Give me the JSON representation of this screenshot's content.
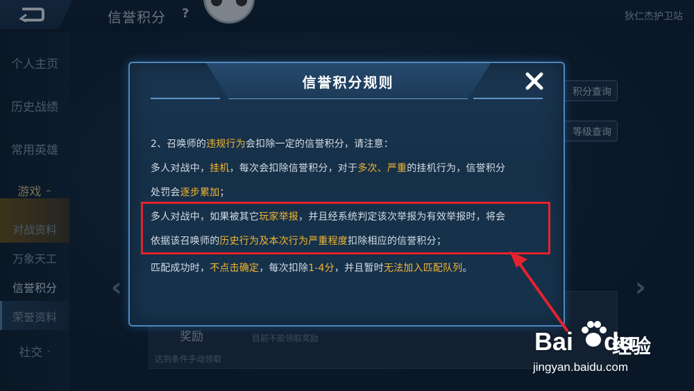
{
  "header": {
    "title": "信誉积分",
    "help_symbol": "?",
    "username": "狄仁杰护卫站"
  },
  "sidebar": {
    "items": [
      {
        "label": "个人主页"
      },
      {
        "label": "历史战绩"
      },
      {
        "label": "常用英雄"
      },
      {
        "label": "游戏"
      },
      {
        "label": "对战资料"
      },
      {
        "label": "万象天工"
      },
      {
        "label": "信誉积分"
      },
      {
        "label": "荣誉资料"
      },
      {
        "label": "社交"
      }
    ]
  },
  "main": {
    "score_query_button": "积分查询",
    "level_query_button": "等级查询",
    "reward_title": "奖励",
    "reward_subtitle": "达到条件手动领取",
    "reward_status": "目前不能领取奖励"
  },
  "modal": {
    "title": "信誉积分规则",
    "lines": [
      {
        "segments": [
          {
            "text": "2、召唤师的",
            "highlight": false
          },
          {
            "text": "违规行为",
            "highlight": true
          },
          {
            "text": "会扣除一定的信誉积分，请注意：",
            "highlight": false
          }
        ]
      },
      {
        "segments": [
          {
            "text": "多人对战中，",
            "highlight": false
          },
          {
            "text": "挂机",
            "highlight": true
          },
          {
            "text": "，每次会扣除信誉积分，对于",
            "highlight": false
          },
          {
            "text": "多次、严重",
            "highlight": true
          },
          {
            "text": "的挂机行为，信誉积分",
            "highlight": false
          }
        ]
      },
      {
        "segments": [
          {
            "text": "处罚会",
            "highlight": false
          },
          {
            "text": "逐步累加",
            "highlight": true
          },
          {
            "text": "；",
            "highlight": false
          }
        ]
      },
      {
        "segments": [
          {
            "text": "多人对战中，如果被其它",
            "highlight": false
          },
          {
            "text": "玩家举报",
            "highlight": true
          },
          {
            "text": "，并且经系统判定该次举报为有效举报时，将会",
            "highlight": false
          }
        ]
      },
      {
        "segments": [
          {
            "text": "依据该召唤师的",
            "highlight": false
          },
          {
            "text": "历史行为及本次行为严重程度",
            "highlight": true
          },
          {
            "text": "扣除相应的信誉积分；",
            "highlight": false
          }
        ]
      },
      {
        "segments": [
          {
            "text": "匹配成功时，",
            "highlight": false
          },
          {
            "text": "不点击确定",
            "highlight": true
          },
          {
            "text": "，每次扣除",
            "highlight": false
          },
          {
            "text": "1-4分",
            "highlight": true
          },
          {
            "text": "，并且暂时",
            "highlight": false
          },
          {
            "text": "无法加入匹配队列",
            "highlight": true
          },
          {
            "text": "。",
            "highlight": false
          }
        ]
      }
    ]
  },
  "watermark": {
    "brand": "Bai",
    "brand_suffix": "du",
    "cn": "经验",
    "url": "jingyan.baidu.com"
  },
  "colors": {
    "highlight_text": "#f2b632",
    "annotation_red": "#e6222e",
    "modal_border": "#4f88be"
  },
  "icons": [
    "back-arrow-icon",
    "help-icon",
    "close-icon",
    "chevron-left-icon",
    "chevron-right-icon",
    "paw-icon"
  ]
}
